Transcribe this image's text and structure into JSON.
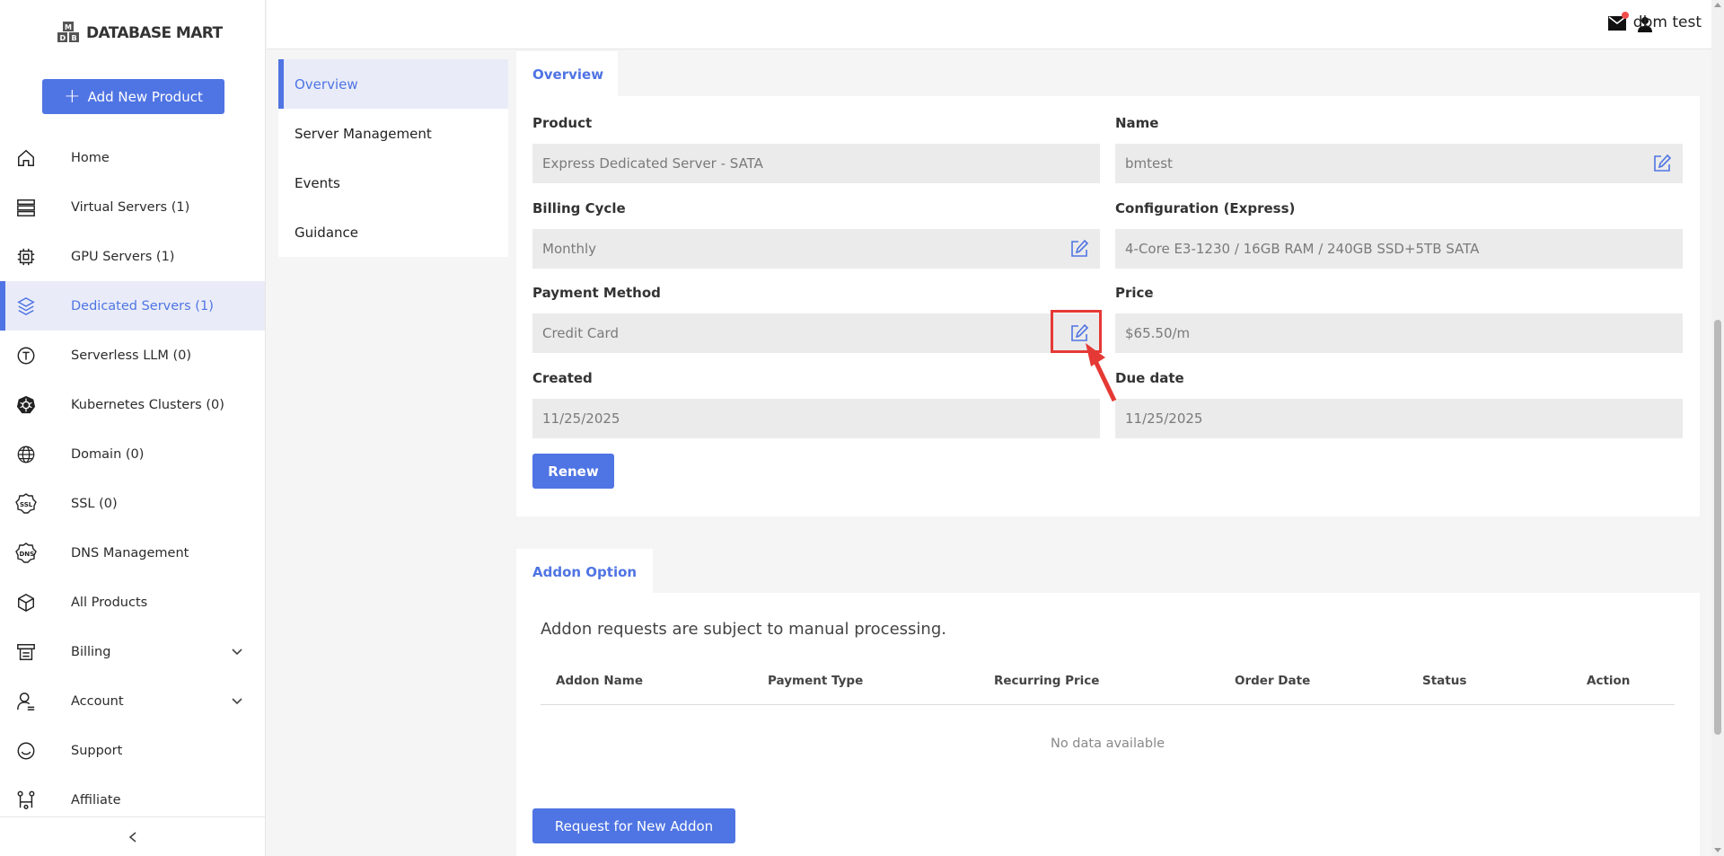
{
  "brand": {
    "name": "DATABASE MART",
    "accent": "#4f74e3"
  },
  "sidebar": {
    "add_button": "Add New Product",
    "items": [
      {
        "label": "Home",
        "icon": "home-icon"
      },
      {
        "label": "Virtual Servers (1)",
        "icon": "server-stack-icon"
      },
      {
        "label": "GPU Servers (1)",
        "icon": "chip-icon"
      },
      {
        "label": "Dedicated Servers (1)",
        "icon": "cube-stack-icon",
        "active": true
      },
      {
        "label": "Serverless LLM (0)",
        "icon": "t-circle-icon"
      },
      {
        "label": "Kubernetes Clusters (0)",
        "icon": "helm-icon"
      },
      {
        "label": "Domain (0)",
        "icon": "globe-icon"
      },
      {
        "label": "SSL (0)",
        "icon": "ssl-badge-icon"
      },
      {
        "label": "DNS Management",
        "icon": "dns-badge-icon"
      },
      {
        "label": "All Products",
        "icon": "box-icon"
      },
      {
        "label": "Billing",
        "icon": "printer-icon",
        "expandable": true
      },
      {
        "label": "Account",
        "icon": "user-icon",
        "expandable": true
      },
      {
        "label": "Support",
        "icon": "support-icon"
      },
      {
        "label": "Affiliate",
        "icon": "network-icon"
      }
    ]
  },
  "topbar": {
    "user_name": "dbm test"
  },
  "submenu": [
    "Overview",
    "Server Management",
    "Events",
    "Guidance"
  ],
  "overview": {
    "tab": "Overview",
    "product_label": "Product",
    "product_value": "Express Dedicated Server - SATA",
    "name_label": "Name",
    "name_value": "bmtest",
    "billing_label": "Billing Cycle",
    "billing_value": "Monthly",
    "config_label": "Configuration (Express)",
    "config_value": "4-Core E3-1230 / 16GB RAM / 240GB SSD+5TB SATA",
    "payment_label": "Payment Method",
    "payment_value": "Credit Card",
    "price_label": "Price",
    "price_value": "$65.50/m",
    "created_label": "Created",
    "created_value": "11/25/2025",
    "due_label": "Due date",
    "due_value": "11/25/2025",
    "renew_button": "Renew"
  },
  "addon": {
    "tab": "Addon Option",
    "note": "Addon requests are subject to manual processing.",
    "columns": [
      "Addon Name",
      "Payment Type",
      "Recurring Price",
      "Order Date",
      "Status",
      "Action"
    ],
    "empty": "No data available",
    "request_button": "Request for New Addon"
  }
}
